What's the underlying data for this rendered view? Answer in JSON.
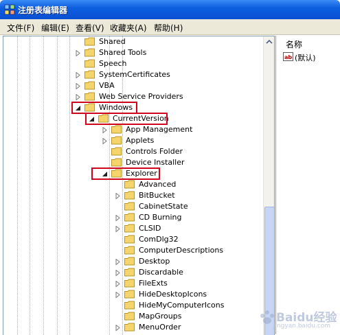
{
  "window": {
    "title": "注册表编辑器",
    "icon": "regedit-icon"
  },
  "menubar": {
    "items": [
      "文件(F)",
      "编辑(E)",
      "查看(V)",
      "收藏夹(A)",
      "帮助(H)"
    ]
  },
  "tree": {
    "rows": [
      {
        "label": "Shared",
        "expander": "none"
      },
      {
        "label": "Shared Tools",
        "expander": "collapsed"
      },
      {
        "label": "Speech",
        "expander": "none"
      },
      {
        "label": "SystemCertificates",
        "expander": "collapsed"
      },
      {
        "label": "VBA",
        "expander": "collapsed"
      },
      {
        "label": "Web Service Providers",
        "expander": "collapsed"
      },
      {
        "label": "Windows",
        "expander": "expanded",
        "highlight": true
      },
      {
        "label": "CurrentVersion",
        "expander": "expanded",
        "highlight": true
      },
      {
        "label": "App Management",
        "expander": "collapsed"
      },
      {
        "label": "Applets",
        "expander": "collapsed"
      },
      {
        "label": "Controls Folder",
        "expander": "none"
      },
      {
        "label": "Device Installer",
        "expander": "none"
      },
      {
        "label": "Explorer",
        "expander": "expanded",
        "highlight": true
      },
      {
        "label": "Advanced",
        "expander": "none"
      },
      {
        "label": "BitBucket",
        "expander": "collapsed"
      },
      {
        "label": "CabinetState",
        "expander": "none"
      },
      {
        "label": "CD Burning",
        "expander": "collapsed"
      },
      {
        "label": "CLSID",
        "expander": "collapsed"
      },
      {
        "label": "ComDlg32",
        "expander": "none"
      },
      {
        "label": "ComputerDescriptions",
        "expander": "none"
      },
      {
        "label": "Desktop",
        "expander": "collapsed"
      },
      {
        "label": "Discardable",
        "expander": "collapsed"
      },
      {
        "label": "FileExts",
        "expander": "collapsed"
      },
      {
        "label": "HideDesktopIcons",
        "expander": "collapsed"
      },
      {
        "label": "HideMyComputerIcons",
        "expander": "none"
      },
      {
        "label": "MapGroups",
        "expander": "none"
      },
      {
        "label": "MenuOrder",
        "expander": "collapsed"
      }
    ]
  },
  "values": {
    "column_header": "名称",
    "items": [
      {
        "label": "(默认)",
        "icon": "string-value-icon"
      }
    ]
  },
  "watermark": {
    "text": "Baidu经验",
    "subtext": "jingyan.baidu.com"
  },
  "colors": {
    "titlebar": "#0a4fd3",
    "highlight": "#d0021b",
    "folder": "#f5d56b"
  }
}
